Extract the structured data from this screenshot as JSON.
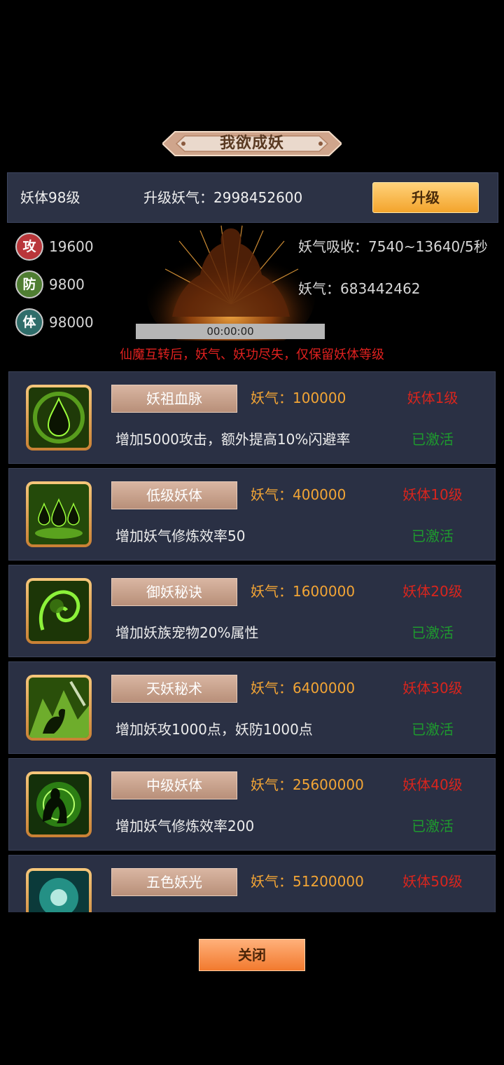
{
  "title": "我欲成妖",
  "top": {
    "level": "妖体98级",
    "upgrade_cost": "升级妖气：2998452600",
    "upgrade_label": "升级"
  },
  "stats": [
    {
      "badge": "攻",
      "value": "19600",
      "color": "#b9363a"
    },
    {
      "badge": "防",
      "value": "9800",
      "color": "#4f7d32"
    },
    {
      "badge": "体",
      "value": "98000",
      "color": "#2f6d6a"
    }
  ],
  "info": {
    "absorb": "妖气吸收：7540~13640/5秒",
    "yaoqi": "妖气：683442462",
    "time": "00:00:00",
    "warning": "仙魔互转后，妖气、妖功尽失，仅保留妖体等级"
  },
  "skills": [
    {
      "name": "妖祖血脉",
      "cost": "妖气：100000",
      "req": "妖体1级",
      "desc": "增加5000攻击，额外提高10%闪避率",
      "status": "已激活",
      "icon": "green-drop-icon"
    },
    {
      "name": "低级妖体",
      "cost": "妖气：400000",
      "req": "妖体10级",
      "desc": "增加妖气修炼效率50",
      "status": "已激活",
      "icon": "three-drops-icon"
    },
    {
      "name": "御妖秘诀",
      "cost": "妖气：1600000",
      "req": "妖体20级",
      "desc": "增加妖族宠物20%属性",
      "status": "已激活",
      "icon": "green-spirit-icon"
    },
    {
      "name": "天妖秘术",
      "cost": "妖气：6400000",
      "req": "妖体30级",
      "desc": "增加妖攻1000点，妖防1000点",
      "status": "已激活",
      "icon": "green-beast-icon"
    },
    {
      "name": "中级妖体",
      "cost": "妖气：25600000",
      "req": "妖体40级",
      "desc": "增加妖气修炼效率200",
      "status": "已激活",
      "icon": "green-figure-icon"
    },
    {
      "name": "五色妖光",
      "cost": "妖气：51200000",
      "req": "妖体50级",
      "desc": "",
      "status": "",
      "icon": "teal-light-icon"
    }
  ],
  "close_label": "关闭"
}
